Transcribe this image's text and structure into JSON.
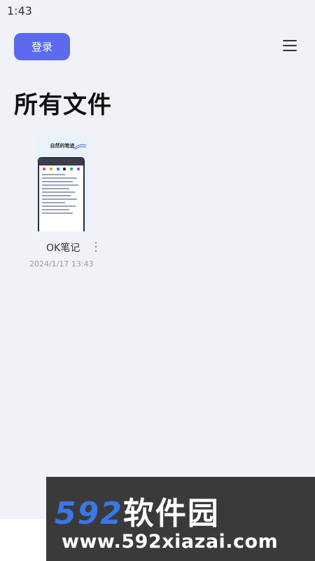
{
  "status_bar": {
    "time": "1:43"
  },
  "header": {
    "login_label": "登录",
    "menu_icon": "hamburger-menu-icon"
  },
  "page": {
    "title": "所有文件"
  },
  "files": [
    {
      "thumbnail_title": "自然的笔迹",
      "name": "OK笔记",
      "date": "2024/1/17 13:43",
      "more_icon": "more-vertical-icon"
    }
  ],
  "watermark": {
    "brand_number": "592",
    "brand_text": "软件园",
    "url": "www.592xiazai.com"
  },
  "colors": {
    "accent": "#5b6bec",
    "background": "#f1f2f7",
    "watermark_blue": "#3a77e6"
  }
}
